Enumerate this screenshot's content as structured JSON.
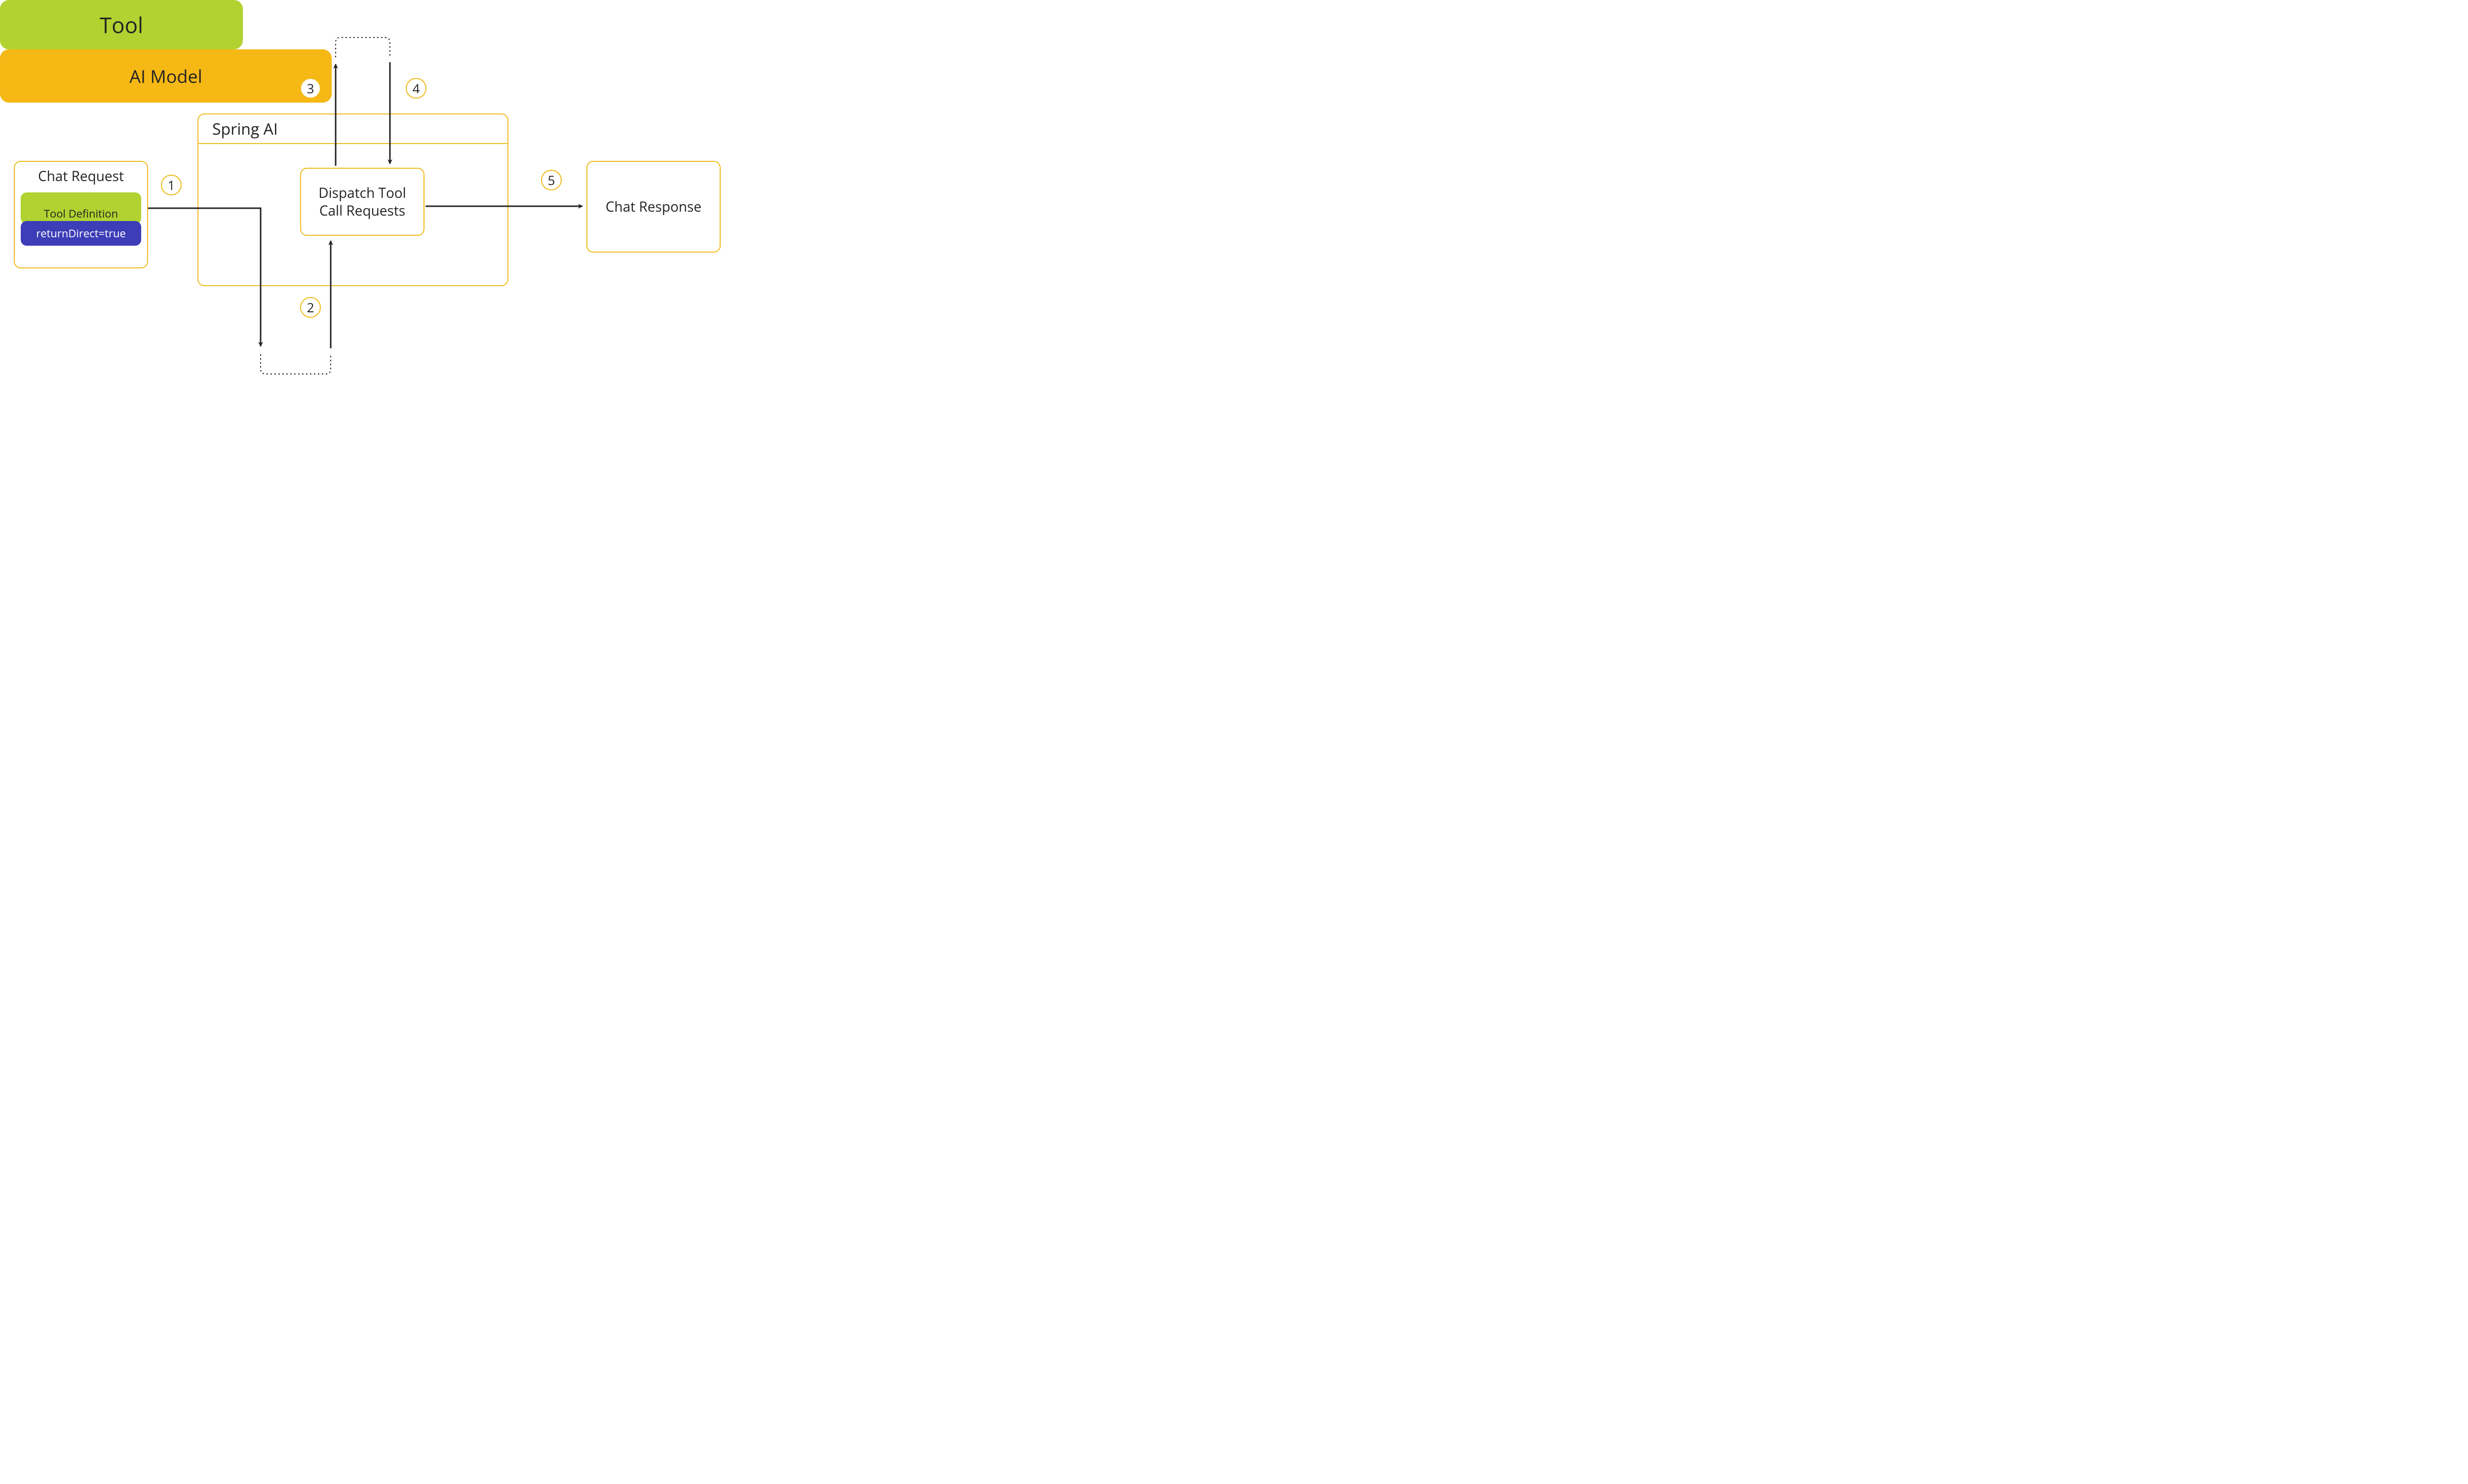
{
  "tool": {
    "label": "Tool"
  },
  "spring": {
    "title": "Spring AI"
  },
  "dispatch": {
    "line1": "Dispatch Tool",
    "line2": "Call Requests"
  },
  "request": {
    "title": "Chat Request",
    "tooldef": "Tool Definition",
    "returndirect": "returnDirect=true"
  },
  "response": {
    "title": "Chat Response"
  },
  "model": {
    "label": "AI Model"
  },
  "steps": {
    "s1": "1",
    "s2": "2",
    "s3": "3",
    "s4": "4",
    "s5": "5"
  }
}
